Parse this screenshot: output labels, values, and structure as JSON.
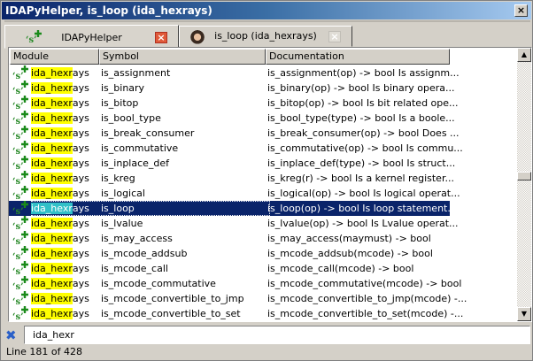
{
  "window": {
    "title": "IDAPyHelper, is_loop (ida_hexrays)",
    "close_label": "×"
  },
  "tabs": [
    {
      "label": "IDAPyHelper",
      "close_label": "×",
      "icon": "python-plus-icon"
    },
    {
      "label": "is_loop (ida_hexrays)",
      "close_label": "×",
      "icon": "portrait-icon"
    }
  ],
  "columns": [
    "Module",
    "Symbol",
    "Documentation"
  ],
  "filter_match": "ida_hexr",
  "rows": [
    {
      "module": "ida_hexrays",
      "symbol": "is_assignment",
      "doc": "is_assignment(op) -> bool     Is assignm..."
    },
    {
      "module": "ida_hexrays",
      "symbol": "is_binary",
      "doc": "is_binary(op) -> bool     Is binary opera..."
    },
    {
      "module": "ida_hexrays",
      "symbol": "is_bitop",
      "doc": "is_bitop(op) -> bool     Is bit related ope..."
    },
    {
      "module": "ida_hexrays",
      "symbol": "is_bool_type",
      "doc": "is_bool_type(type) -> bool     Is a boole..."
    },
    {
      "module": "ida_hexrays",
      "symbol": "is_break_consumer",
      "doc": "is_break_consumer(op) -> bool     Does ..."
    },
    {
      "module": "ida_hexrays",
      "symbol": "is_commutative",
      "doc": "is_commutative(op) -> bool     Is commu..."
    },
    {
      "module": "ida_hexrays",
      "symbol": "is_inplace_def",
      "doc": "is_inplace_def(type) -> bool     Is struct..."
    },
    {
      "module": "ida_hexrays",
      "symbol": "is_kreg",
      "doc": "is_kreg(r) -> bool     Is a kernel register..."
    },
    {
      "module": "ida_hexrays",
      "symbol": "is_logical",
      "doc": "is_logical(op) -> bool     Is logical operat..."
    },
    {
      "module": "ida_hexrays",
      "symbol": "is_loop",
      "doc": "is_loop(op) -> bool     Is loop statement...",
      "selected": true
    },
    {
      "module": "ida_hexrays",
      "symbol": "is_lvalue",
      "doc": "is_lvalue(op) -> bool     Is Lvalue operat..."
    },
    {
      "module": "ida_hexrays",
      "symbol": "is_may_access",
      "doc": "is_may_access(maymust) -> bool"
    },
    {
      "module": "ida_hexrays",
      "symbol": "is_mcode_addsub",
      "doc": "is_mcode_addsub(mcode) -> bool"
    },
    {
      "module": "ida_hexrays",
      "symbol": "is_mcode_call",
      "doc": "is_mcode_call(mcode) -> bool"
    },
    {
      "module": "ida_hexrays",
      "symbol": "is_mcode_commutative",
      "doc": "is_mcode_commutative(mcode) -> bool"
    },
    {
      "module": "ida_hexrays",
      "symbol": "is_mcode_convertible_to_jmp",
      "doc": "is_mcode_convertible_to_jmp(mcode) -..."
    },
    {
      "module": "ida_hexrays",
      "symbol": "is_mcode_convertible_to_set",
      "doc": "is_mcode_convertible_to_set(mcode) -..."
    }
  ],
  "filter": {
    "value": "ida_hexr",
    "clear_icon": "✖"
  },
  "status": "Line 181 of 428",
  "colors": {
    "selection": "#0a246a",
    "highlight": "#ffff00",
    "selected_highlight": "#31c0c8"
  }
}
